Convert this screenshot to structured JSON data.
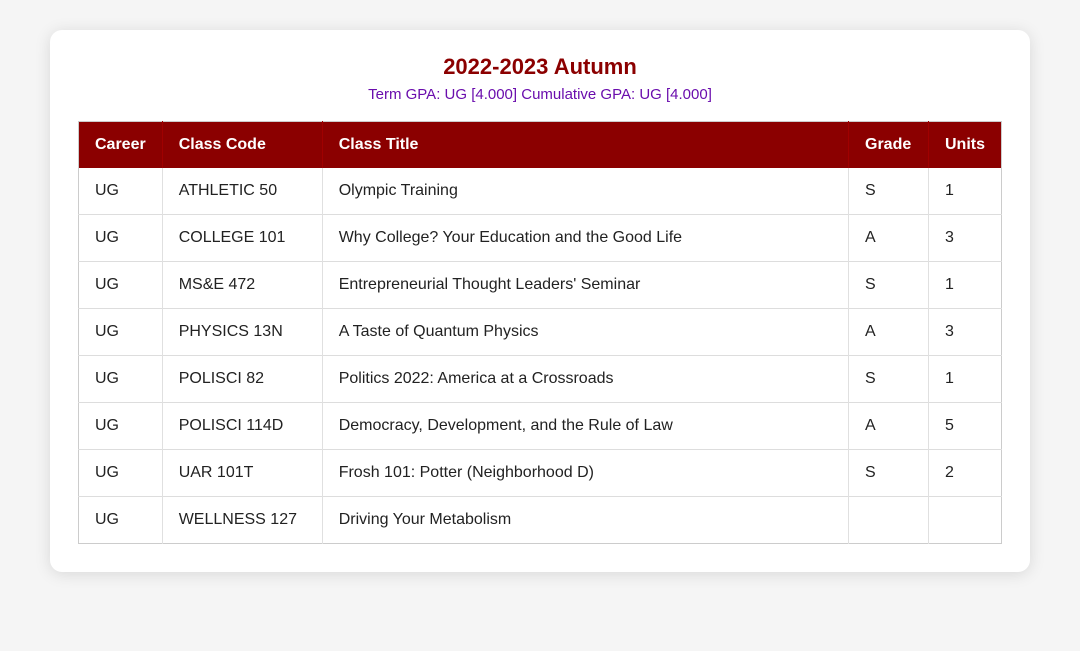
{
  "header": {
    "title": "2022-2023 Autumn",
    "gpa_text": "Term GPA: UG [4.000]  Cumulative GPA: UG [4.000]"
  },
  "table": {
    "columns": [
      {
        "key": "career",
        "label": "Career"
      },
      {
        "key": "classcode",
        "label": "Class Code"
      },
      {
        "key": "classtitle",
        "label": "Class Title"
      },
      {
        "key": "grade",
        "label": "Grade"
      },
      {
        "key": "units",
        "label": "Units"
      }
    ],
    "rows": [
      {
        "career": "UG",
        "classcode": "ATHLETIC  50",
        "classtitle": "Olympic Training",
        "grade": "S",
        "units": "1"
      },
      {
        "career": "UG",
        "classcode": "COLLEGE  101",
        "classtitle": "Why College? Your Education and the Good Life",
        "grade": "A",
        "units": "3"
      },
      {
        "career": "UG",
        "classcode": "MS&E  472",
        "classtitle": "Entrepreneurial Thought Leaders' Seminar",
        "grade": "S",
        "units": "1"
      },
      {
        "career": "UG",
        "classcode": "PHYSICS  13N",
        "classtitle": "A Taste of Quantum Physics",
        "grade": "A",
        "units": "3"
      },
      {
        "career": "UG",
        "classcode": "POLISCI  82",
        "classtitle": "Politics 2022: America at a Crossroads",
        "grade": "S",
        "units": "1"
      },
      {
        "career": "UG",
        "classcode": "POLISCI  114D",
        "classtitle": "Democracy, Development, and the Rule of Law",
        "grade": "A",
        "units": "5"
      },
      {
        "career": "UG",
        "classcode": "UAR  101T",
        "classtitle": "Frosh 101: Potter (Neighborhood D)",
        "grade": "S",
        "units": "2"
      },
      {
        "career": "UG",
        "classcode": "WELLNESS  127",
        "classtitle": "Driving Your Metabolism",
        "grade": "",
        "units": ""
      }
    ]
  }
}
